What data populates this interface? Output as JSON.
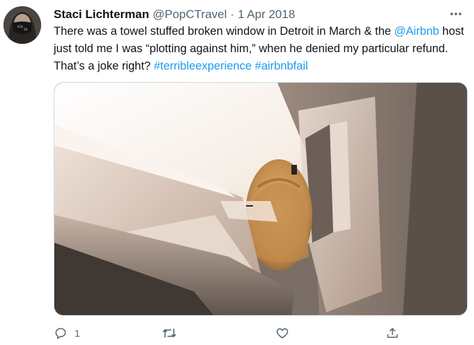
{
  "tweet": {
    "author_name": "Staci Lichterman",
    "author_handle": "@PopCTravel",
    "separator": "·",
    "date": "1 Apr 2018",
    "text_segments": [
      {
        "text": "There was a towel stuffed broken window in Detroit in March & the ",
        "link": false
      },
      {
        "text": "@Airbnb",
        "link": true
      },
      {
        "text": " host just told me I was “plotting against him,” when he denied my particular refund. That’s a joke right? ",
        "link": false
      },
      {
        "text": "#terribleexperience",
        "link": true
      },
      {
        "text": " ",
        "link": false
      },
      {
        "text": "#airbnbfail",
        "link": true
      }
    ],
    "reply_count": "1",
    "icons": {
      "more": "more-options-icon",
      "reply": "reply-icon",
      "retweet": "retweet-icon",
      "like": "like-icon",
      "share": "share-icon"
    },
    "colors": {
      "link": "#1d9bf0",
      "secondary_text": "#536471",
      "border": "#cfd9de"
    }
  }
}
